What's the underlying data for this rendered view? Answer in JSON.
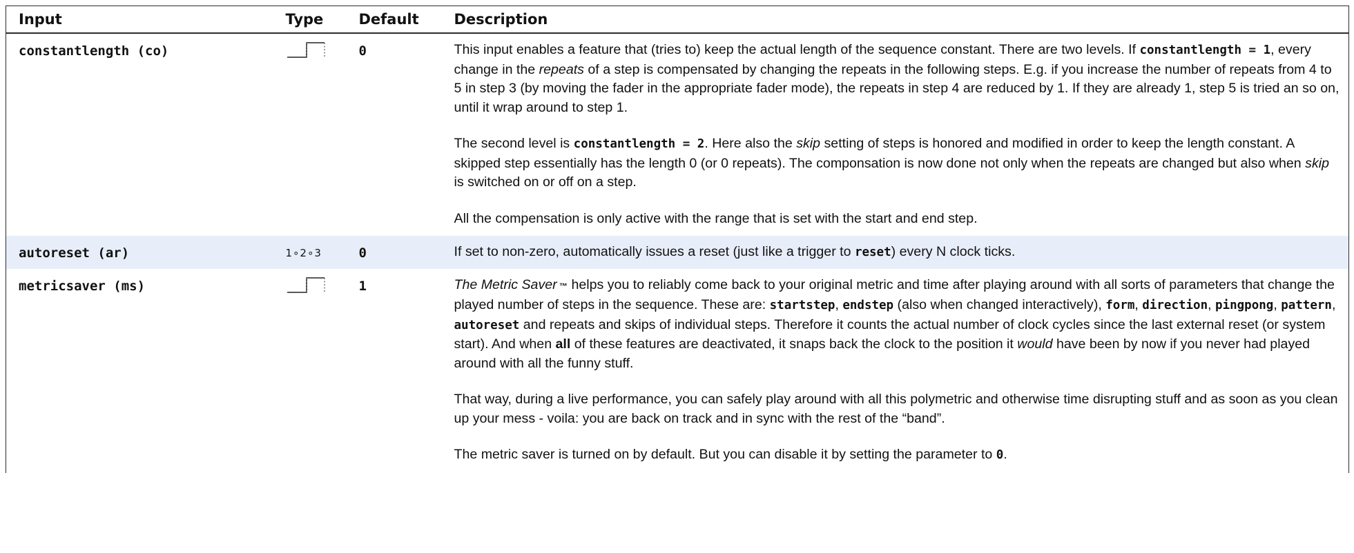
{
  "table": {
    "headers": {
      "input": "Input",
      "type": "Type",
      "default": "Default",
      "description": "Description"
    },
    "rows": [
      {
        "input": "constantlength (co)",
        "type_icon": "gate-icon",
        "default": "0",
        "description": [
          [
            {
              "t": "This input enables a feature that (tries to) keep the actual length of the sequence constant.  There are two levels.  If "
            },
            {
              "t": "constantlength = 1",
              "s": "code"
            },
            {
              "t": ", every change in the "
            },
            {
              "t": "repeats",
              "s": "em"
            },
            {
              "t": " of a step is compensated by changing the repeats in the following steps.  E.g.  if you increase the number of repeats from 4 to 5 in step 3 (by moving the fader in the appropriate fader mode), the repeats in step 4 are reduced by 1.  If they are already 1, step 5 is tried an so on, until it wrap around to step 1."
            }
          ],
          [
            {
              "t": "The second level is "
            },
            {
              "t": "constantlength = 2",
              "s": "code"
            },
            {
              "t": ".  Here also the "
            },
            {
              "t": "skip",
              "s": "em"
            },
            {
              "t": " setting of steps is honored and modified in order to keep the length constant.  A skipped step essentially has the length 0 (or 0 repeats).  The componsation is now done not only when the repeats are changed but also when "
            },
            {
              "t": "skip",
              "s": "em"
            },
            {
              "t": " is switched on or off on a step."
            }
          ],
          [
            {
              "t": "All the compensation is only active with the range that is set with the start and end step."
            }
          ]
        ]
      },
      {
        "input": "autoreset (ar)",
        "type_icon": "integer-icon",
        "type_text": "1∘2∘3",
        "default": "0",
        "description": [
          [
            {
              "t": "If set to non-zero, automatically issues a reset (just like a trigger to "
            },
            {
              "t": "reset",
              "s": "code"
            },
            {
              "t": ") every N clock ticks."
            }
          ]
        ]
      },
      {
        "input": "metricsaver (ms)",
        "type_icon": "gate-icon",
        "default": "1",
        "description": [
          [
            {
              "t": "The Metric Saver",
              "s": "em"
            },
            {
              "t": " ™",
              "s": "tm"
            },
            {
              "t": " helps you to reliably come back to your original metric and time after playing around with all sorts of parameters that change the played number of steps in the sequence.  These are:  "
            },
            {
              "t": "startstep",
              "s": "code"
            },
            {
              "t": ", "
            },
            {
              "t": "endstep",
              "s": "code"
            },
            {
              "t": " (also when changed interactively), "
            },
            {
              "t": "form",
              "s": "code"
            },
            {
              "t": ", "
            },
            {
              "t": "direction",
              "s": "code"
            },
            {
              "t": ", "
            },
            {
              "t": "pingpong",
              "s": "code"
            },
            {
              "t": ", "
            },
            {
              "t": "pattern",
              "s": "code"
            },
            {
              "t": ", "
            },
            {
              "t": "autoreset",
              "s": "code"
            },
            {
              "t": " and repeats and skips of individual steps.  Therefore it counts the actual number of clock cycles since the last external reset (or system start).  And when "
            },
            {
              "t": "all",
              "s": "b"
            },
            {
              "t": " of these features are deactivated, it snaps back the clock to the position it "
            },
            {
              "t": "would",
              "s": "em"
            },
            {
              "t": " have been by now if you never had played around with all the funny stuff."
            }
          ],
          [
            {
              "t": "That way, during a live performance, you can safely play around with all this polymetric and otherwise time disrupting stuff and as soon as you clean up your mess - voila:  you are back on track and in sync with the rest of the “band”."
            }
          ],
          [
            {
              "t": "The metric saver is turned on by default.  But you can disable it by setting the parameter to "
            },
            {
              "t": "0",
              "s": "code"
            },
            {
              "t": "."
            }
          ]
        ]
      }
    ]
  }
}
